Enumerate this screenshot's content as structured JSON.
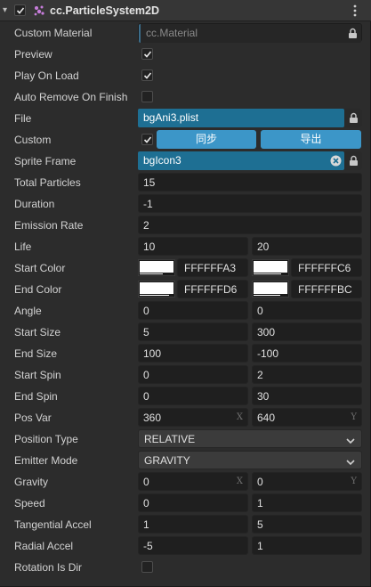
{
  "header": {
    "title": "cc.ParticleSystem2D",
    "chevron": "▾"
  },
  "props": {
    "custom_material": {
      "label": "Custom Material",
      "value": "cc.Material"
    },
    "preview": {
      "label": "Preview",
      "checked": true
    },
    "play_on_load": {
      "label": "Play On Load",
      "checked": true
    },
    "auto_remove": {
      "label": "Auto Remove On Finish",
      "checked": false
    },
    "file": {
      "label": "File",
      "value": "bgAni3.plist"
    },
    "custom": {
      "label": "Custom",
      "checked": true,
      "btn_sync": "同步",
      "btn_export": "导出"
    },
    "sprite_frame": {
      "label": "Sprite Frame",
      "value": "bgIcon3"
    },
    "total_particles": {
      "label": "Total Particles",
      "value": "15"
    },
    "duration": {
      "label": "Duration",
      "value": "-1"
    },
    "emission_rate": {
      "label": "Emission Rate",
      "value": "2"
    },
    "life": {
      "label": "Life",
      "a": "10",
      "b": "20"
    },
    "start_color": {
      "label": "Start Color",
      "hex_a": "FFFFFFA3",
      "hex_b": "FFFFFFC6"
    },
    "end_color": {
      "label": "End Color",
      "hex_a": "FFFFFFD6",
      "hex_b": "FFFFFFBC"
    },
    "angle": {
      "label": "Angle",
      "a": "0",
      "b": "0"
    },
    "start_size": {
      "label": "Start Size",
      "a": "5",
      "b": "300"
    },
    "end_size": {
      "label": "End Size",
      "a": "100",
      "b": "-100"
    },
    "start_spin": {
      "label": "Start Spin",
      "a": "0",
      "b": "2"
    },
    "end_spin": {
      "label": "End Spin",
      "a": "0",
      "b": "30"
    },
    "pos_var": {
      "label": "Pos Var",
      "a": "360",
      "b": "640",
      "axis_a": "X",
      "axis_b": "Y"
    },
    "position_type": {
      "label": "Position Type",
      "value": "RELATIVE"
    },
    "emitter_mode": {
      "label": "Emitter Mode",
      "value": "GRAVITY"
    },
    "gravity": {
      "label": "Gravity",
      "a": "0",
      "b": "0",
      "axis_a": "X",
      "axis_b": "Y"
    },
    "speed": {
      "label": "Speed",
      "a": "0",
      "b": "1"
    },
    "tangential_accel": {
      "label": "Tangential Accel",
      "a": "1",
      "b": "5"
    },
    "radial_accel": {
      "label": "Radial Accel",
      "a": "-5",
      "b": "1"
    },
    "rotation_is_dir": {
      "label": "Rotation Is Dir",
      "checked": false
    }
  },
  "colors": {
    "accent": "#3c96c8",
    "asset_blue": "#1e6f93",
    "field_bg": "#1f1f1f",
    "panel_bg": "#2c2c2c"
  },
  "icons": {
    "component": "particle-icon",
    "menu": "vertical-dots-icon",
    "lock": "lock-icon",
    "clear": "clear-circle-icon",
    "dropdown": "chevron-down-icon",
    "check": "checkmark-icon"
  }
}
